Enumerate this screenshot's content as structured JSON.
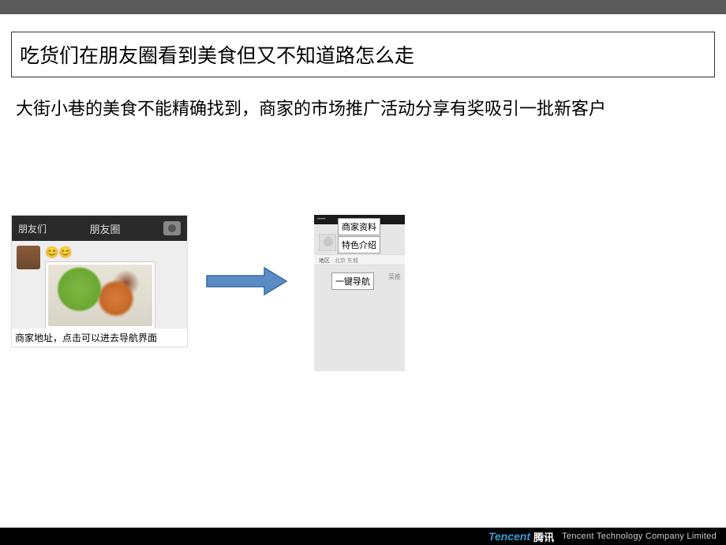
{
  "slide": {
    "title": "吃货们在朋友圈看到美食但又不知道路怎么走",
    "subtitle": "大街小巷的美食不能精确找到，商家的市场推广活动分享有奖吸引一批新客户"
  },
  "left_mock": {
    "friends": "朋友们",
    "header_title": "朋友圈",
    "emoji": "😊😊",
    "caption": "商家地址，点击可以进去导航界面"
  },
  "right_mock": {
    "label_merchant": "商家资料",
    "label_feature": "特色介绍",
    "label_nav": "一键导航",
    "tag_label": "地区",
    "tag_value": "北京 东城",
    "recommend": "菜推"
  },
  "footer": {
    "logo_en": "Tencent",
    "logo_cn": "腾讯",
    "company": "Tencent Technology Company Limited"
  }
}
